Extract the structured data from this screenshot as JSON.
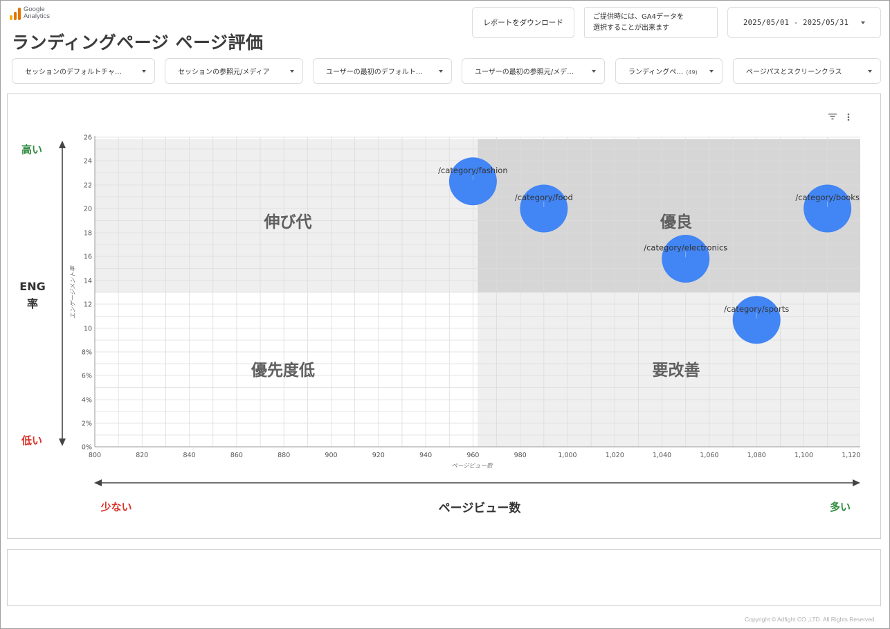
{
  "brand": {
    "line1": "Google",
    "line2": "Analytics"
  },
  "page_title": "ランディングページ ページ評価",
  "header": {
    "download_label": "レポートをダウンロード",
    "info_line1": "ご提供時には、GA4データを",
    "info_line2": "選択することが出来ます",
    "date_range": "2025/05/01 - 2025/05/31"
  },
  "filters": [
    {
      "label": "セッションのデフォルトチャ…"
    },
    {
      "label": "セッションの参照元/メディア"
    },
    {
      "label": "ユーザーの最初のデフォルト…"
    },
    {
      "label": "ユーザーの最初の参照元/メデ…"
    },
    {
      "label": "ランディングペ…",
      "count": "(49)"
    },
    {
      "label": "ページパスとスクリーンクラス"
    }
  ],
  "quadrants": {
    "top_left": "伸び代",
    "top_right": "優良",
    "bottom_left": "優先度低",
    "bottom_right": "要改善"
  },
  "y_guide": {
    "high": "高い",
    "label_line1": "ENG",
    "label_line2": "率",
    "low": "低い"
  },
  "x_guide": {
    "low": "少ない",
    "label": "ページビュー数",
    "high": "多い"
  },
  "colors": {
    "bubble": "#4285f4",
    "high": "#2e8b3e",
    "low": "#d93025",
    "quad_good": "#d6d6d6",
    "quad_light": "#efefef"
  },
  "copyright": "Copyright © Adfight CO.,LTD. All Rights Reserved.",
  "chart_data": {
    "type": "scatter",
    "xlabel": "ページビュー数",
    "ylabel": "エンゲージメント率",
    "xlim": [
      800,
      1125
    ],
    "ylim": [
      0,
      26
    ],
    "x_ticks": [
      "800",
      "820",
      "840",
      "860",
      "880",
      "900",
      "920",
      "940",
      "960",
      "980",
      "1,000",
      "1,020",
      "1,040",
      "1,060",
      "1,080",
      "1,100",
      "1,120"
    ],
    "y_ticks": [
      "0%",
      "2%",
      "4%",
      "6%",
      "8%",
      "10",
      "12",
      "14",
      "16",
      "18",
      "20",
      "22",
      "24",
      "26"
    ],
    "grid": true,
    "quadrant_split": {
      "x": 962,
      "y": 13
    },
    "points": [
      {
        "label": "/category/fashion",
        "x": 960,
        "y": 22.3
      },
      {
        "label": "/category/food",
        "x": 990,
        "y": 20.0
      },
      {
        "label": "/category/electronics",
        "x": 1050,
        "y": 15.8
      },
      {
        "label": "/category/books",
        "x": 1110,
        "y": 20.0
      },
      {
        "label": "/category/sports",
        "x": 1080,
        "y": 10.7
      }
    ]
  }
}
